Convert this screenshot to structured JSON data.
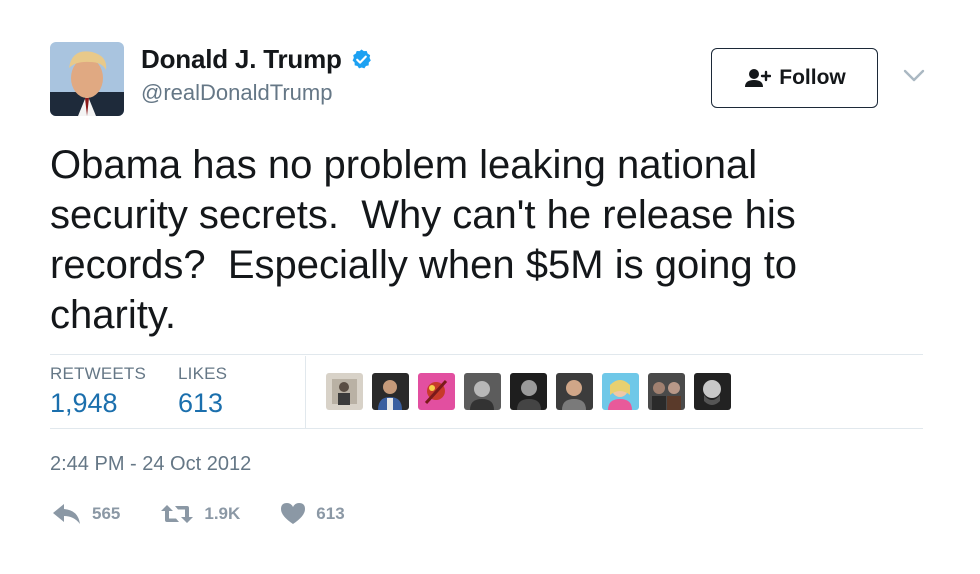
{
  "tweet": {
    "display_name": "Donald J. Trump",
    "handle": "@realDonaldTrump",
    "verified": true,
    "text": "Obama has no problem leaking national\nsecurity secrets.  Why can't he release his\nrecords?  Especially when $5M is going to\ncharity.",
    "timestamp": "2:44 PM - 24 Oct 2012"
  },
  "follow_button": {
    "label": "Follow",
    "icon": "add-user-icon"
  },
  "stats": {
    "retweets_label": "RETWEETS",
    "retweets_value": "1,948",
    "likes_label": "LIKES",
    "likes_value": "613"
  },
  "liked_by": {
    "avatars": [
      "avatar-1",
      "avatar-2",
      "avatar-3",
      "avatar-4",
      "avatar-5",
      "avatar-6",
      "avatar-7",
      "avatar-8",
      "avatar-9"
    ]
  },
  "actions": {
    "reply_count": "565",
    "retweet_count": "1.9K",
    "like_count": "613"
  },
  "colors": {
    "text": "#14171a",
    "secondary": "#657786",
    "link_blue": "#1b6fad",
    "verified_blue": "#1da1f2",
    "divider": "#e1e8ed",
    "action_gray": "#8b98a5"
  }
}
